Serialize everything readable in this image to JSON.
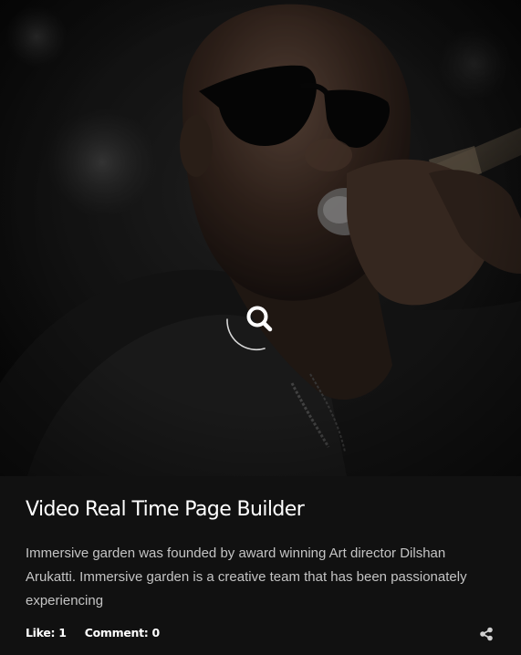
{
  "post": {
    "title": "Video Real Time Page Builder",
    "excerpt": "Immersive garden was founded by award winning Art director Dilshan Arukatti. Immersive garden is a creative team that has been passionately experiencing",
    "likes_label": "Like: 1",
    "comments_label": "Comment:  0"
  },
  "icons": {
    "overlay": "search-icon",
    "share": "share-icon"
  },
  "colors": {
    "background": "#111111",
    "title": "#ffffff",
    "excerpt": "#c4c4c4",
    "meta": "#ffffff"
  }
}
